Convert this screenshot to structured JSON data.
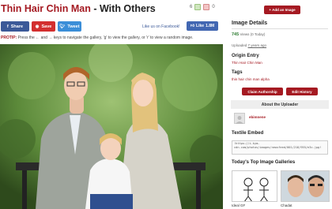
{
  "page": {
    "title_accent": "Thin Hair Chin Man",
    "title_rest": " - With Others"
  },
  "votes": {
    "up_count": "6",
    "down_count": "0"
  },
  "share": {
    "facebook": "Share",
    "save": "Save",
    "tweet": "Tweet",
    "like_text": "Like us on Facebook!",
    "like_btn": "Like",
    "like_count": "1.8M"
  },
  "protip": {
    "label": "PROTIP:",
    "text": " Press the ← and → keys to navigate the gallery, 'g' to view the gallery, or 'r' to view a random image."
  },
  "sidebar": {
    "add_image": "+ Add an Image",
    "details_heading": "Image Details",
    "views_num": "745",
    "views_label": "Views",
    "views_note": "(0 Today)",
    "uploaded_label": "Uploaded",
    "uploaded_value": "7 years ago",
    "origin_heading": "Origin Entry",
    "origin_value": "Thin Hair Chin Man",
    "tags_heading": "Tags",
    "tags_value": "thin hair chin man alpha",
    "claim_btn": "Claim Authorship",
    "edit_btn": "Edit History",
    "uploader_section": "About the Uploader",
    "uploader_name": "ebimnene",
    "embed_heading": "Textile Embed",
    "embed_text": "!https://i.kym-cdn.com/photos/images/newsfeed/001/218/955/e3c.jpg!",
    "galleries_heading": "Today's Top Image Galleries",
    "gallery_1_label": "Ideal GF",
    "gallery_2_label": "Chadat"
  },
  "colors": {
    "accent": "#a51a22",
    "facebook": "#3b5998",
    "twitter": "#3b8ed8",
    "views": "#2e7d32"
  }
}
